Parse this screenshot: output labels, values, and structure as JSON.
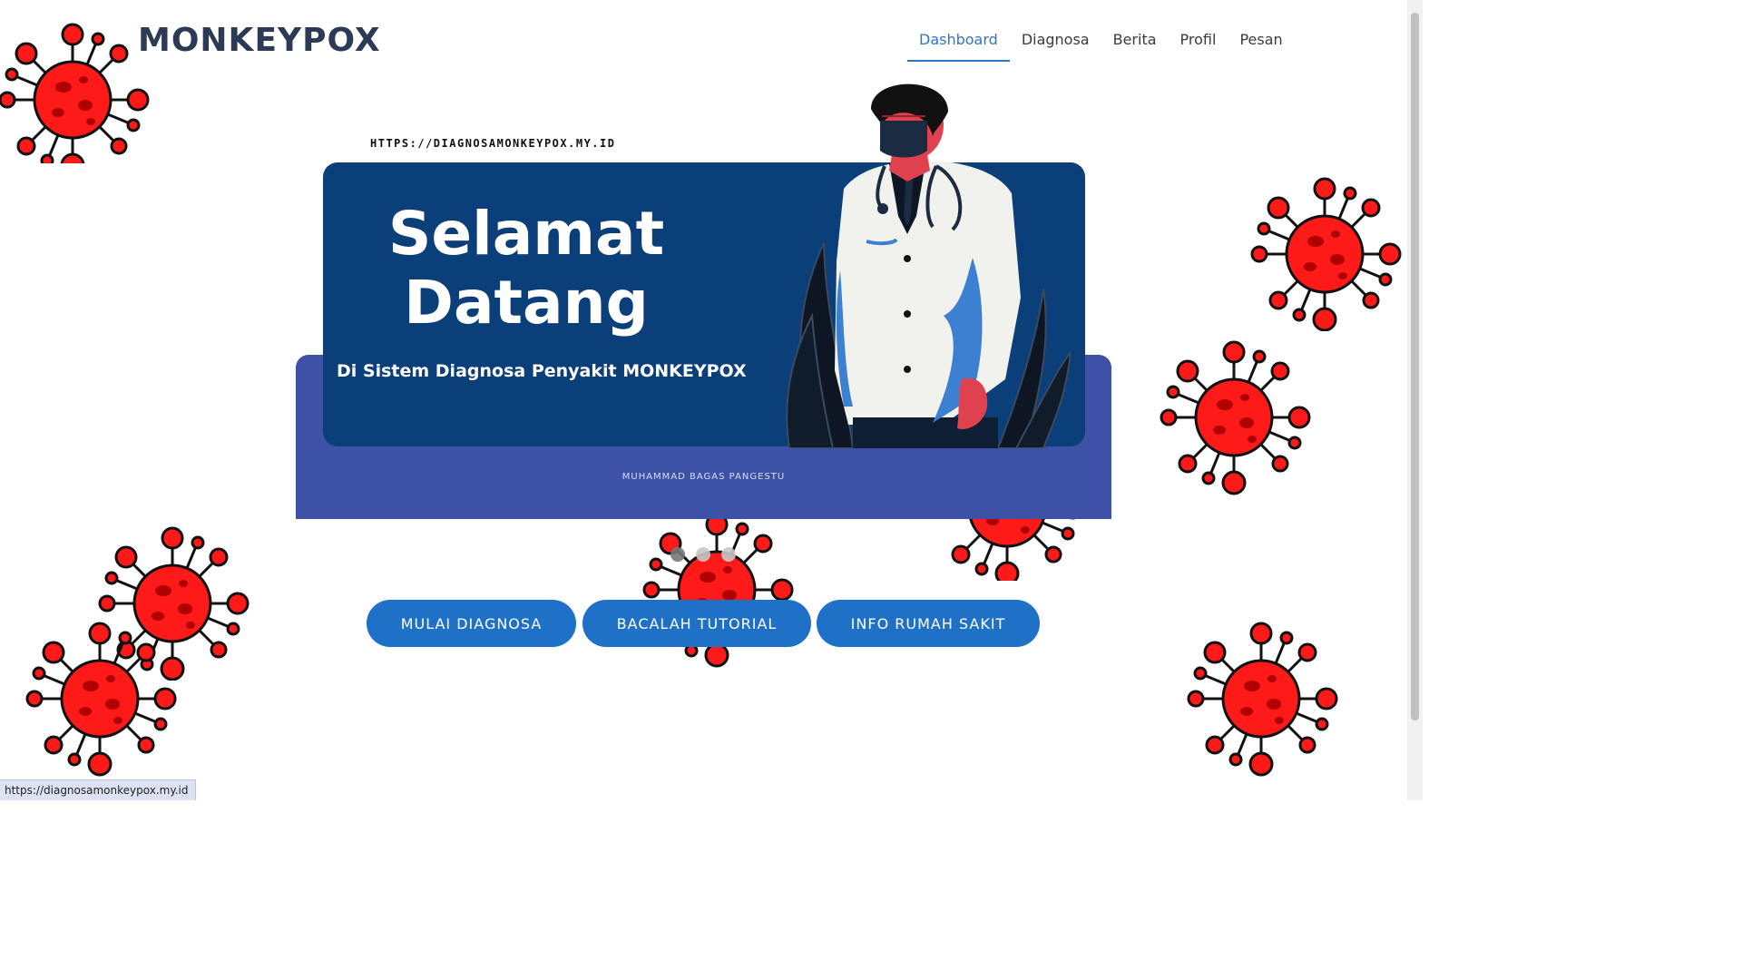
{
  "header": {
    "brand": "MONKEYPOX",
    "nav": [
      {
        "label": "Dashboard",
        "active": true
      },
      {
        "label": "Diagnosa",
        "active": false
      },
      {
        "label": "Berita",
        "active": false
      },
      {
        "label": "Profil",
        "active": false
      },
      {
        "label": "Pesan",
        "active": false
      }
    ]
  },
  "banner": {
    "url_text": "HTTPS://DIAGNOSAMONKEYPOX.MY.ID",
    "headline_line1": "Selamat",
    "headline_line2": "Datang",
    "subheadline": "Di Sistem Diagnosa Penyakit MONKEYPOX",
    "author": "MUHAMMAD BAGAS PANGESTU"
  },
  "carousel": {
    "active_slide": 1,
    "slide_count": 3
  },
  "actions": {
    "start_diagnosis": "MULAI DIAGNOSA",
    "read_tutorial": "BACALAH TUTORIAL",
    "hospital_info": "INFO RUMAH SAKIT"
  },
  "status_bar": {
    "hover_url": "https://diagnosamonkeypox.my.id"
  },
  "colors": {
    "brand_text": "#2b3b55",
    "nav_active": "#2e74c9",
    "banner_dark": "#0b3f79",
    "banner_band": "#3d51a7",
    "button": "#1f71c8",
    "virus_red": "#ff1a1a"
  }
}
